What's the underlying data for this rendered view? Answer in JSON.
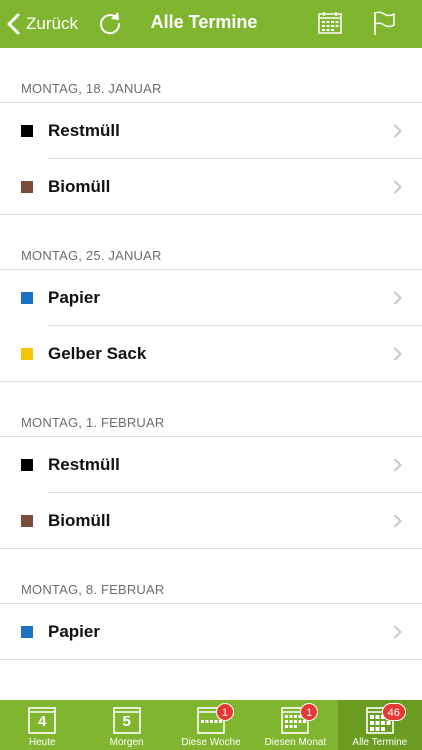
{
  "navbar": {
    "back_label": "Zurück",
    "title": "Alle Termine"
  },
  "sections": [
    {
      "date": "MONTAG, 18. JANUAR",
      "items": [
        {
          "label": "Restmüll",
          "color": "#000000"
        },
        {
          "label": "Biomüll",
          "color": "#7a4a3a"
        }
      ]
    },
    {
      "date": "MONTAG, 25. JANUAR",
      "items": [
        {
          "label": "Papier",
          "color": "#1a72c0"
        },
        {
          "label": "Gelber Sack",
          "color": "#f3c400"
        }
      ]
    },
    {
      "date": "MONTAG, 1. FEBRUAR",
      "items": [
        {
          "label": "Restmüll",
          "color": "#000000"
        },
        {
          "label": "Biomüll",
          "color": "#7a4a3a"
        }
      ]
    },
    {
      "date": "MONTAG, 8. FEBRUAR",
      "items": [
        {
          "label": "Papier",
          "color": "#1a72c0"
        }
      ]
    }
  ],
  "tabbar": {
    "tabs": [
      {
        "label": "Heute",
        "day": "4",
        "icon": "calendar-day-icon"
      },
      {
        "label": "Morgen",
        "day": "5",
        "icon": "calendar-day-icon"
      },
      {
        "label": "Diese Woche",
        "badge": "1",
        "icon": "calendar-week-icon"
      },
      {
        "label": "Diesen Monat",
        "badge": "1",
        "icon": "calendar-month-icon"
      },
      {
        "label": "Alle Termine",
        "badge": "46",
        "icon": "calendar-all-icon",
        "active": true
      }
    ]
  },
  "colors": {
    "accent": "#7fb52f",
    "badge": "#e53935"
  }
}
